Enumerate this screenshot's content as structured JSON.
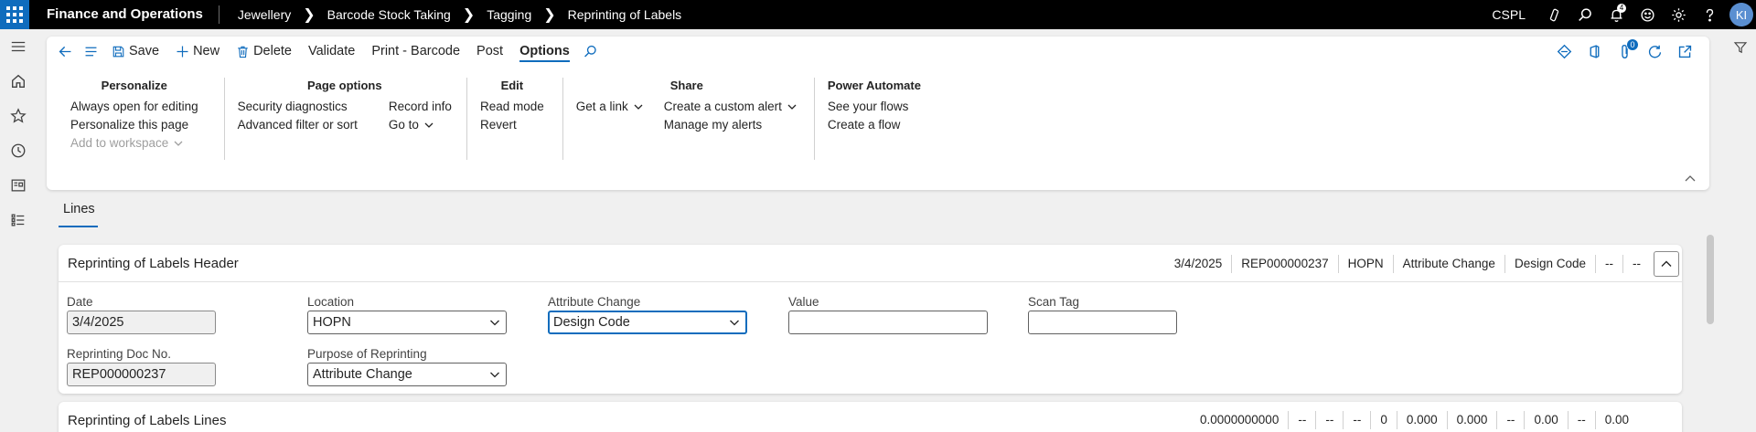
{
  "topbar": {
    "app_title": "Finance and Operations",
    "breadcrumbs": [
      "Jewellery",
      "Barcode Stock Taking",
      "Tagging",
      "Reprinting of Labels"
    ],
    "company": "CSPL",
    "notification_count": "4",
    "avatar_initials": "KI"
  },
  "toolbar": {
    "save": "Save",
    "new": "New",
    "delete": "Delete",
    "validate": "Validate",
    "print_barcode": "Print - Barcode",
    "post": "Post",
    "options": "Options",
    "attachments_count": "0"
  },
  "options_groups": {
    "personalize": {
      "title": "Personalize",
      "items": [
        "Always open for editing",
        "Personalize this page",
        "Add to workspace"
      ]
    },
    "page_options": {
      "title": "Page options",
      "col1": [
        "Security diagnostics",
        "Advanced filter or sort"
      ],
      "col2": [
        "Record info",
        "Go to"
      ]
    },
    "edit": {
      "title": "Edit",
      "items": [
        "Read mode",
        "Revert"
      ]
    },
    "share": {
      "title": "Share",
      "col1": [
        "Get a link"
      ],
      "col2": [
        "Create a custom alert",
        "Manage my alerts"
      ]
    },
    "power_automate": {
      "title": "Power Automate",
      "items": [
        "See your flows",
        "Create a flow"
      ]
    }
  },
  "tabs": {
    "lines": "Lines"
  },
  "header_card": {
    "title": "Reprinting of Labels Header",
    "summary": [
      "3/4/2025",
      "REP000000237",
      "HOPN",
      "Attribute Change",
      "Design Code",
      "--",
      "--"
    ],
    "fields": {
      "date": {
        "label": "Date",
        "value": "3/4/2025"
      },
      "location": {
        "label": "Location",
        "value": "HOPN"
      },
      "attribute_change": {
        "label": "Attribute Change",
        "value": "Design Code"
      },
      "value": {
        "label": "Value",
        "value": ""
      },
      "scan_tag": {
        "label": "Scan Tag",
        "value": ""
      },
      "reprinting_doc_no": {
        "label": "Reprinting Doc No.",
        "value": "REP000000237"
      },
      "purpose": {
        "label": "Purpose of Reprinting",
        "value": "Attribute Change"
      }
    }
  },
  "lines_card": {
    "title": "Reprinting of Labels Lines",
    "summary": [
      "0.0000000000",
      "--",
      "--",
      "--",
      "0",
      "0.000",
      "0.000",
      "--",
      "0.00",
      "--",
      "0.00"
    ]
  }
}
